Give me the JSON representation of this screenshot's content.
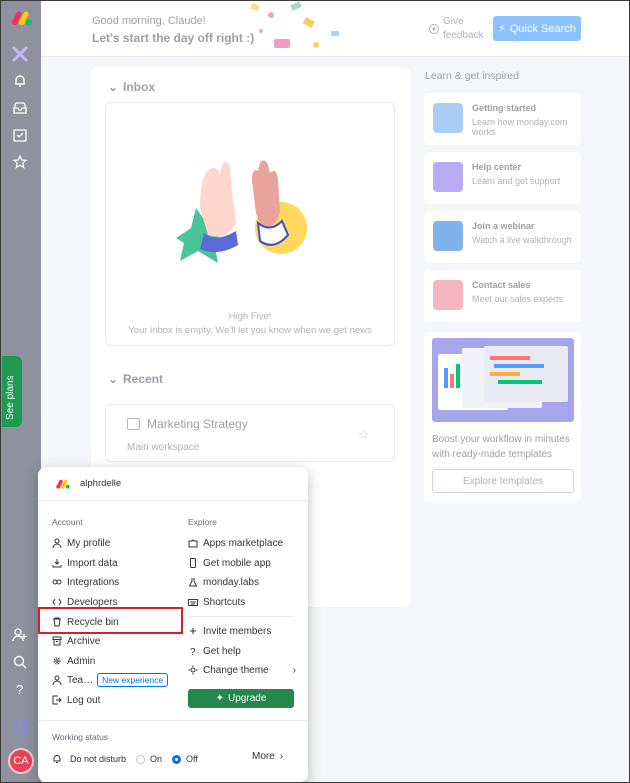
{
  "header": {
    "greeting": "Good morning, Claude!",
    "subtitle": "Let's start the day off right :)",
    "feedback_label": "Give feedback",
    "quick_search_label": "Quick Search"
  },
  "main": {
    "inbox_title": "Inbox",
    "high_five_title": "High Five!",
    "high_five_text": "Your inbox is empty, We'll let you know when we get news",
    "recent_title": "Recent",
    "recent_item_name": "Marketing Strategy",
    "recent_item_workspace": "Main workspace"
  },
  "learn": {
    "title": "Learn & get inspired",
    "cards": [
      {
        "title": "Getting started",
        "subtitle": "Learn how monday.com works",
        "color": "#a9cdf7"
      },
      {
        "title": "Help center",
        "subtitle": "Learn and get support",
        "color": "#b9acf3"
      },
      {
        "title": "Join a webinar",
        "subtitle": "Watch a live walkthrough",
        "color": "#7fb3ea"
      },
      {
        "title": "Contact sales",
        "subtitle": "Meet our sales experts",
        "color": "#f5b6c1"
      }
    ],
    "templates_text": "Boost your workflow in minutes with ready-made templates",
    "templates_button": "Explore templates"
  },
  "rail": {
    "see_plans_label": "See plans",
    "avatar_initials": "CA"
  },
  "popup": {
    "account_name": "alphrdelle",
    "account_title": "Account",
    "explore_title": "Explore",
    "account_items": [
      {
        "label": "My profile",
        "icon": "person-icon"
      },
      {
        "label": "Import data",
        "icon": "import-icon"
      },
      {
        "label": "Integrations",
        "icon": "integrations-icon"
      },
      {
        "label": "Developers",
        "icon": "code-icon"
      },
      {
        "label": "Recycle bin",
        "icon": "trash-icon"
      },
      {
        "label": "Archive",
        "icon": "archive-icon"
      },
      {
        "label": "Admin",
        "icon": "gear-icon"
      },
      {
        "label": "Tea…",
        "icon": "team-icon",
        "badge": "New experience"
      },
      {
        "label": "Log out",
        "icon": "logout-icon"
      }
    ],
    "explore_items": [
      {
        "label": "Apps marketplace",
        "icon": "puzzle-icon"
      },
      {
        "label": "Get mobile app",
        "icon": "mobile-icon"
      },
      {
        "label": "monday.labs",
        "icon": "flask-icon"
      },
      {
        "label": "Shortcuts",
        "icon": "keyboard-icon"
      },
      {
        "label": "Invite members",
        "icon": "plus-icon"
      },
      {
        "label": "Get help",
        "icon": "question-icon"
      },
      {
        "label": "Change theme",
        "icon": "theme-icon"
      }
    ],
    "upgrade_label": "Upgrade",
    "working_status_title": "Working status",
    "dnd_label": "Do not disturb",
    "on_label": "On",
    "off_label": "Off",
    "off_selected": true,
    "more_label": "More"
  },
  "colors": {
    "brand_blue": "#0073ea",
    "upgrade_green": "#258750",
    "highlight_red": "#d81f25"
  }
}
